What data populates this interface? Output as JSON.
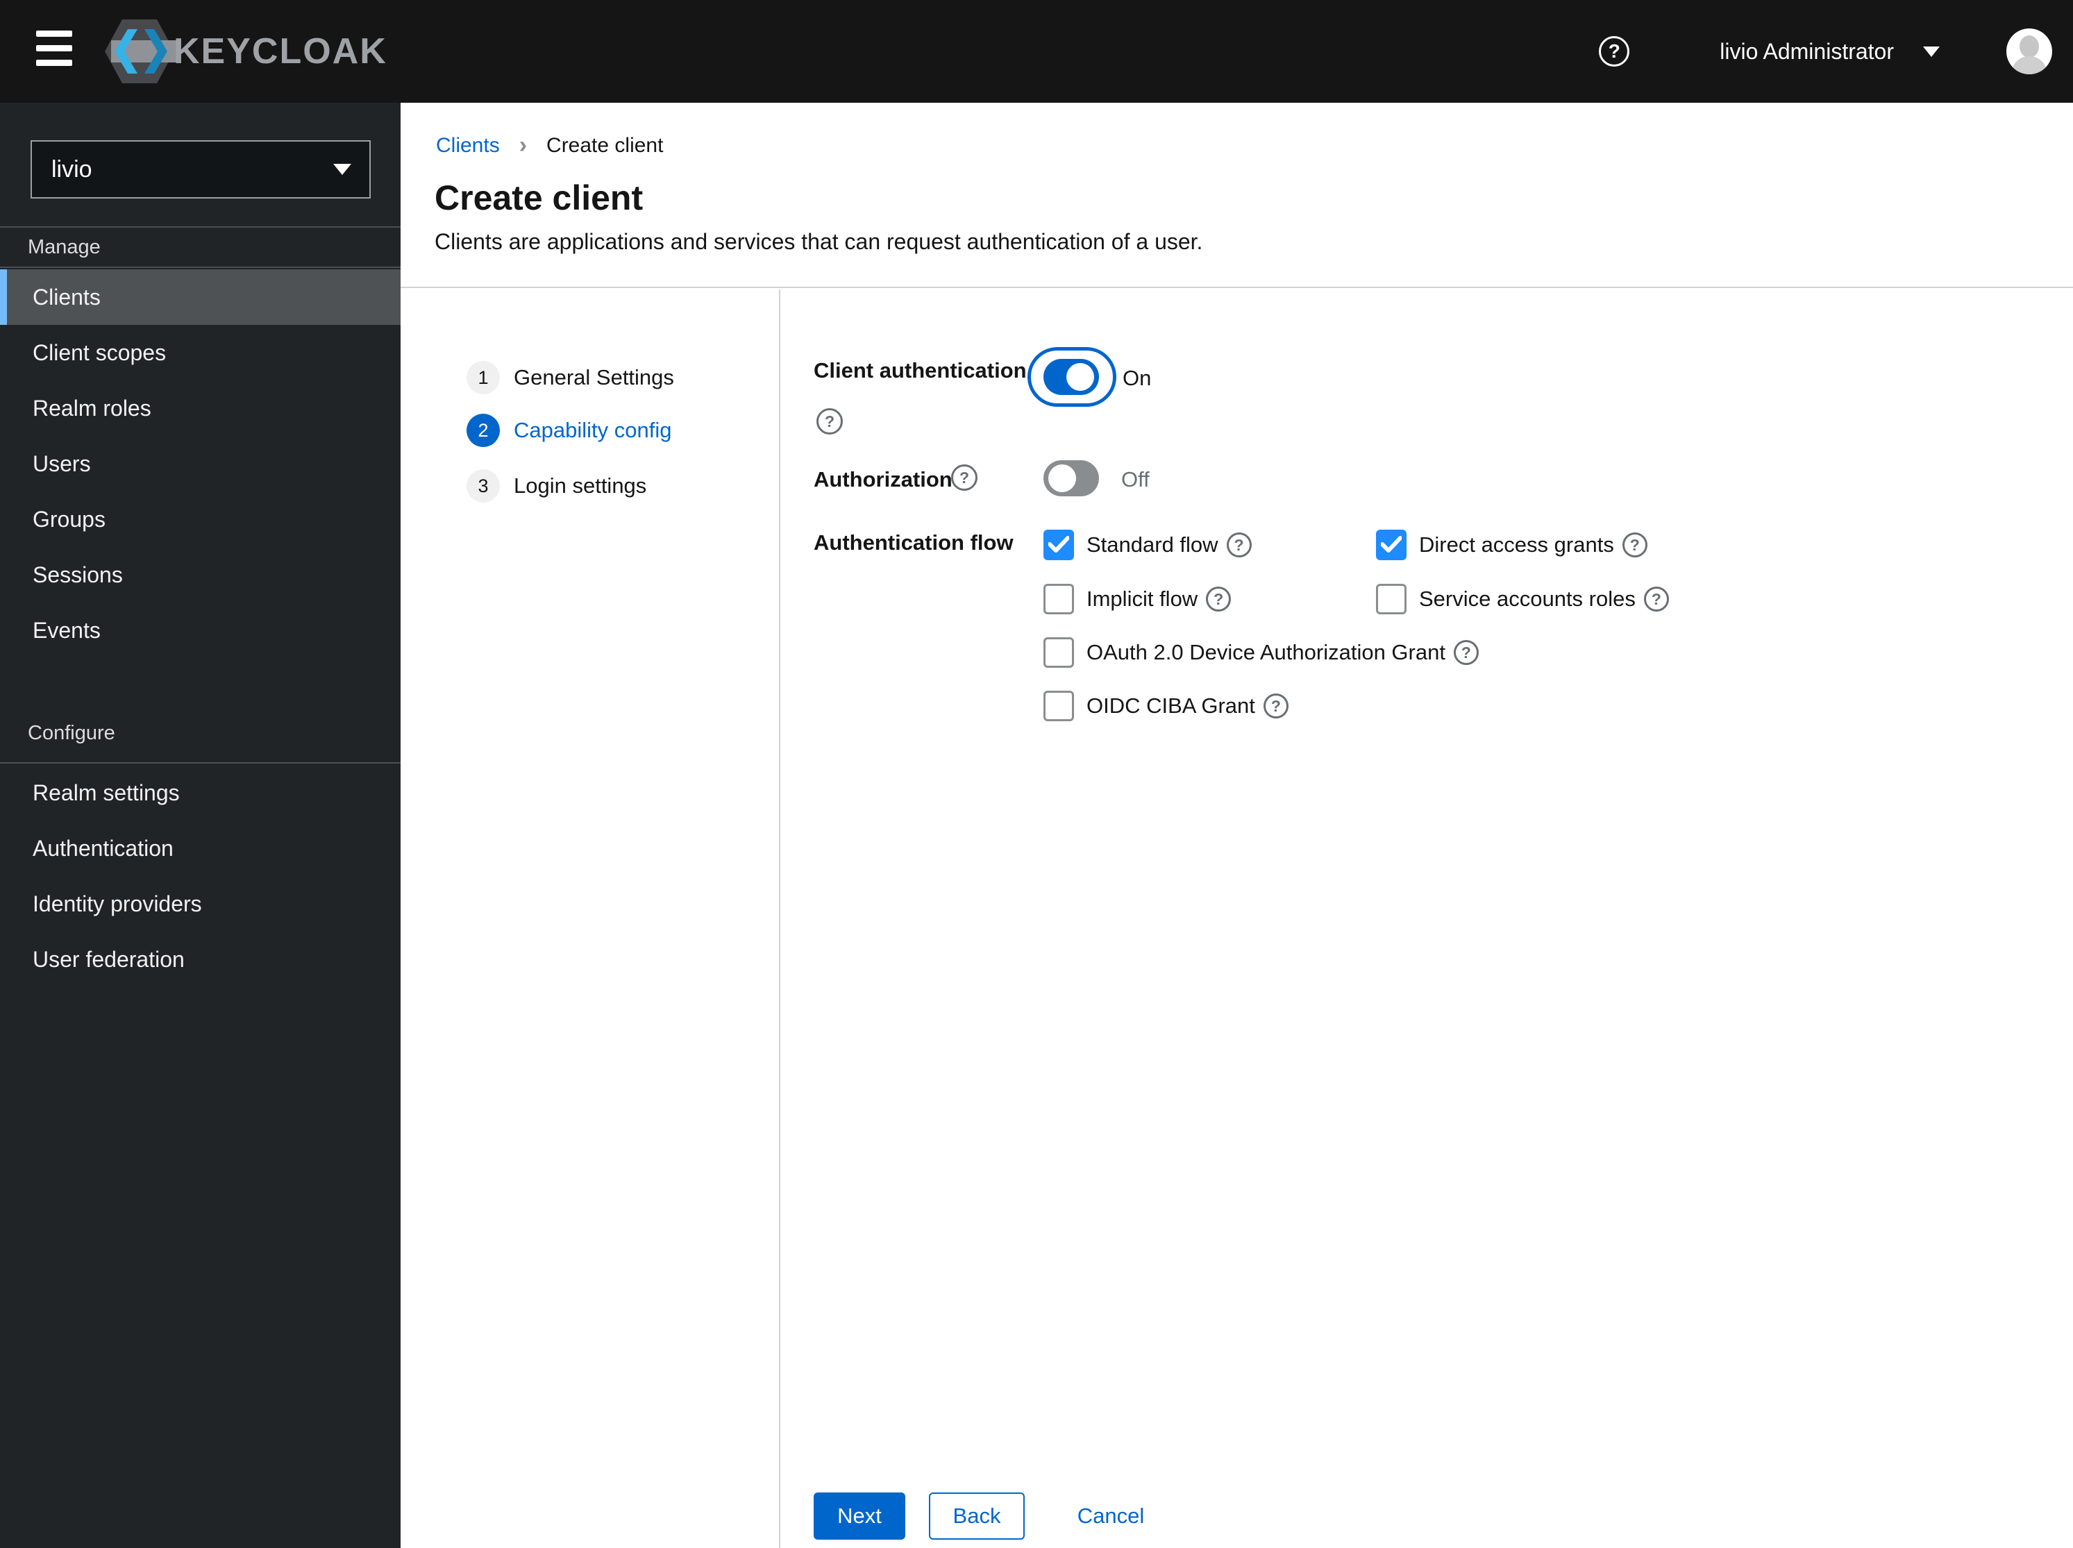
{
  "header": {
    "brand": "KEYCLOAK",
    "user_menu": {
      "label": "livio Administrator"
    }
  },
  "icons": {
    "help": "?",
    "breadcrumb_separator": "›"
  },
  "sidebar": {
    "realm_selector": {
      "value": "livio"
    },
    "sections": [
      {
        "title": "Manage",
        "items": [
          {
            "label": "Clients",
            "selected": true
          },
          {
            "label": "Client scopes",
            "selected": false
          },
          {
            "label": "Realm roles",
            "selected": false
          },
          {
            "label": "Users",
            "selected": false
          },
          {
            "label": "Groups",
            "selected": false
          },
          {
            "label": "Sessions",
            "selected": false
          },
          {
            "label": "Events",
            "selected": false
          }
        ]
      },
      {
        "title": "Configure",
        "items": [
          {
            "label": "Realm settings",
            "selected": false
          },
          {
            "label": "Authentication",
            "selected": false
          },
          {
            "label": "Identity providers",
            "selected": false
          },
          {
            "label": "User federation",
            "selected": false
          }
        ]
      }
    ]
  },
  "breadcrumb": {
    "items": [
      {
        "label": "Clients",
        "link": true
      },
      {
        "label": "Create client",
        "link": false
      }
    ]
  },
  "page": {
    "title": "Create client",
    "description": "Clients are applications and services that can request authentication of a user."
  },
  "wizard": {
    "steps": [
      {
        "number": "1",
        "label": "General Settings",
        "active": false
      },
      {
        "number": "2",
        "label": "Capability config",
        "active": true
      },
      {
        "number": "3",
        "label": "Login settings",
        "active": false
      }
    ]
  },
  "form": {
    "client_authentication": {
      "label": "Client authentication",
      "state": "On",
      "enabled": true
    },
    "authorization": {
      "label": "Authorization",
      "state": "Off",
      "enabled": false
    },
    "authentication_flow": {
      "label": "Authentication flow",
      "options": [
        {
          "label": "Standard flow",
          "checked": true
        },
        {
          "label": "Direct access grants",
          "checked": true
        },
        {
          "label": "Implicit flow",
          "checked": false
        },
        {
          "label": "Service accounts roles",
          "checked": false
        },
        {
          "label": "OAuth 2.0 Device Authorization Grant",
          "checked": false
        },
        {
          "label": "OIDC CIBA Grant",
          "checked": false
        }
      ]
    },
    "actions": {
      "next": "Next",
      "back": "Back",
      "cancel": "Cancel"
    }
  },
  "colors": {
    "header_bg": "#151515",
    "sidebar_bg": "#212427",
    "selected_item_bg": "#4f5255",
    "selected_item_accent": "#73bcf7",
    "primary": "#0066cc",
    "checkbox_checked": "#1e8bff",
    "toggle_off": "#8a8d90",
    "divider": "#d2d2d2",
    "muted_text": "#6a6e73"
  }
}
